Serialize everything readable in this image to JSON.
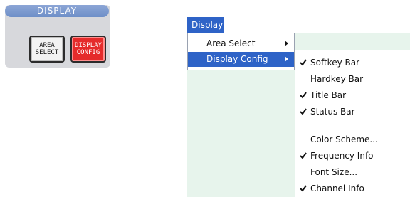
{
  "hardkey_panel": {
    "title": "DISPLAY",
    "buttons": [
      {
        "line1": "AREA",
        "line2": "SELECT",
        "active": false
      },
      {
        "line1": "DISPLAY",
        "line2": "CONFIG",
        "active": true
      }
    ]
  },
  "menubar": {
    "item": "Display"
  },
  "menu": {
    "items": [
      {
        "label": "Area Select",
        "highlighted": false,
        "has_submenu": true
      },
      {
        "label": "Display Config",
        "highlighted": true,
        "has_submenu": true
      }
    ]
  },
  "submenu": {
    "items": [
      {
        "label": "Softkey Bar",
        "checked": true
      },
      {
        "label": "Hardkey Bar",
        "checked": false
      },
      {
        "label": "Title Bar",
        "checked": true
      },
      {
        "label": "Status Bar",
        "checked": true
      },
      {
        "label": "Color Scheme...",
        "checked": false
      },
      {
        "label": "Frequency Info",
        "checked": true
      },
      {
        "label": "Font Size...",
        "checked": false
      },
      {
        "label": "Channel Info",
        "checked": true
      }
    ]
  },
  "colors": {
    "highlight": "#2e63c7",
    "active_hardkey": "#e52b2b",
    "panel_bg": "#d7d8dc"
  }
}
